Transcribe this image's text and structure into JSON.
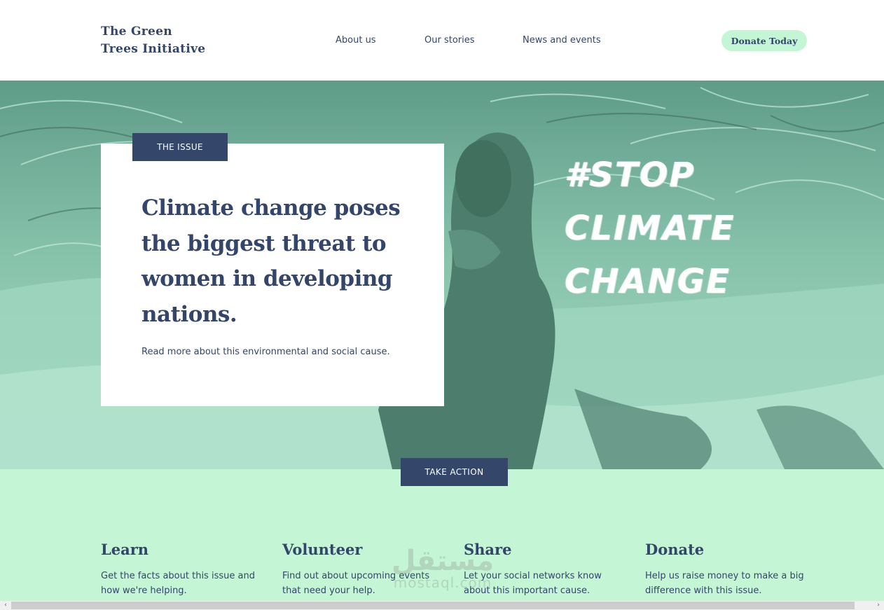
{
  "header": {
    "logo_line1": "The Green",
    "logo_line2": "Trees Initiative",
    "nav": [
      "About us",
      "Our stories",
      "News and events"
    ],
    "donate_label": "Donate Today"
  },
  "hero": {
    "tag": "THE ISSUE",
    "headline": "Climate change poses the biggest threat to women in developing nations.",
    "read_more": "Read more about this environmental and social cause.",
    "stop_lines": [
      "#STOP",
      "CLIMATE",
      "CHANGE"
    ]
  },
  "action": {
    "button_label": "TAKE ACTION",
    "columns": [
      {
        "title": "Learn",
        "text": "Get the facts about this issue and how we're helping."
      },
      {
        "title": "Volunteer",
        "text": "Find out about upcoming events that need your help."
      },
      {
        "title": "Share",
        "text": "Let your social networks know about this important cause."
      },
      {
        "title": "Donate",
        "text": "Help us raise money to make a big difference with this issue."
      }
    ]
  },
  "watermark": {
    "arabic": "مستقل",
    "latin": "mostaql.com"
  },
  "scrollbar": {
    "left_arrow": "‹",
    "right_arrow": "›"
  },
  "colors": {
    "navy": "#34466a",
    "mint": "#c4f5d4",
    "hero_tint": "#8fc9b3"
  }
}
